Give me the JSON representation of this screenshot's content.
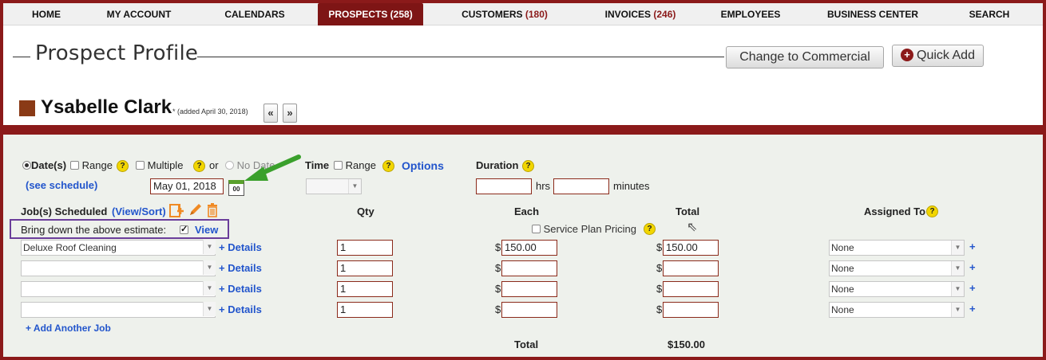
{
  "nav": {
    "items": [
      {
        "label": "HOME",
        "count": ""
      },
      {
        "label": "MY ACCOUNT",
        "count": ""
      },
      {
        "label": "CALENDARS",
        "count": ""
      },
      {
        "label": "PROSPECTS",
        "count": "(258)"
      },
      {
        "label": "CUSTOMERS",
        "count": "(180)"
      },
      {
        "label": "INVOICES",
        "count": "(246)"
      },
      {
        "label": "EMPLOYEES",
        "count": ""
      },
      {
        "label": "BUSINESS CENTER",
        "count": ""
      },
      {
        "label": "SEARCH",
        "count": ""
      }
    ],
    "active": "PROSPECTS"
  },
  "header": {
    "title": "Prospect Profile",
    "change_button": "Change to Commercial",
    "quick_add_button": "Quick Add",
    "quick_add_icon": "+",
    "prospect_name": "Ysabelle Clark",
    "added_note": "* (added April 30, 2018)",
    "prev_label": "«",
    "next_label": "»"
  },
  "schedule": {
    "dates_label": "Date(s)",
    "range_label": "Range",
    "multiple_label": "Multiple",
    "or_label": "or",
    "no_date_label": "No Date",
    "see_schedule_link": "(see schedule)",
    "date_value": "May 01, 2018",
    "calendar_icon_text": "00",
    "time_label": "Time",
    "time_range_label": "Range",
    "options_link": "Options",
    "duration_label": "Duration",
    "hrs_label": "hrs",
    "minutes_label": "minutes",
    "help_glyph": "?"
  },
  "jobs": {
    "header_label": "Job(s) Scheduled",
    "view_sort_link": "(View/Sort)",
    "bring_down_label": "Bring down the above estimate:",
    "view_link": "View",
    "col_qty": "Qty",
    "col_each": "Each",
    "col_total": "Total",
    "col_assigned": "Assigned To",
    "service_plan_label": "Service Plan Pricing",
    "details_link": "+ Details",
    "currency": "$",
    "assigned_plus": "+",
    "rows": [
      {
        "job": "Deluxe Roof Cleaning",
        "qty": "1",
        "each": "150.00",
        "total": "150.00",
        "assigned": "None"
      },
      {
        "job": "",
        "qty": "1",
        "each": "",
        "total": "",
        "assigned": "None"
      },
      {
        "job": "",
        "qty": "1",
        "each": "",
        "total": "",
        "assigned": "None"
      },
      {
        "job": "",
        "qty": "1",
        "each": "",
        "total": "",
        "assigned": "None"
      }
    ],
    "add_another_link": "+ Add Another Job",
    "grand_total_label": "Total",
    "grand_total_value": "$150.00"
  },
  "colors": {
    "brand": "#8b1a1a",
    "link": "#2255cc",
    "highlight_box": "#6a3d9a",
    "arrow": "#3aa02c",
    "help": "#f2d600"
  },
  "icons": {
    "add_job_icon": "add-document-icon",
    "edit_icon": "pencil-icon",
    "delete_icon": "trash-icon",
    "calendar_icon": "calendar-icon",
    "help_icon": "help-circle-icon"
  }
}
